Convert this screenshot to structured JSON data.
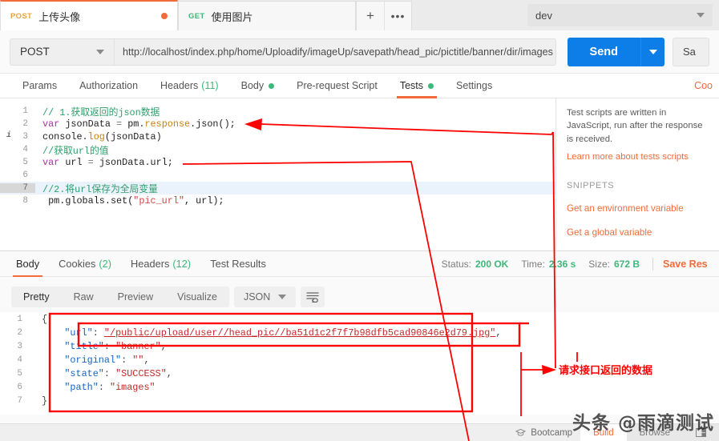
{
  "tabs": [
    {
      "method": "POST",
      "name": "上传头像",
      "active": true,
      "unsaved": true
    },
    {
      "method": "GET",
      "name": "使用图片",
      "active": false,
      "unsaved": false
    }
  ],
  "tab_tools": {
    "add": "+",
    "more": "•••"
  },
  "environment": {
    "selected": "dev"
  },
  "request": {
    "method": "POST",
    "url": "http://localhost/index.php/home/Uploadify/imageUp/savepath/head_pic/pictitle/banner/dir/images",
    "send_label": "Send",
    "save_label": "Sa"
  },
  "request_tabs": [
    {
      "label": "Params",
      "count": "",
      "dot": false,
      "active": false
    },
    {
      "label": "Authorization",
      "count": "",
      "dot": false,
      "active": false
    },
    {
      "label": "Headers",
      "count": "(11)",
      "dot": false,
      "active": false
    },
    {
      "label": "Body",
      "count": "",
      "dot": true,
      "active": false
    },
    {
      "label": "Pre-request Script",
      "count": "",
      "dot": false,
      "active": false
    },
    {
      "label": "Tests",
      "count": "",
      "dot": true,
      "active": true
    },
    {
      "label": "Settings",
      "count": "",
      "dot": false,
      "active": false
    }
  ],
  "cookies_link": "Coo",
  "code": {
    "lines": [
      {
        "num": "1",
        "text": "// 1.获取返回的json数据",
        "kind": "comment",
        "highlight": false,
        "info": false
      },
      {
        "num": "2",
        "text": "var jsonData = pm.response.json();",
        "kind": "code",
        "highlight": false,
        "info": false
      },
      {
        "num": "3",
        "text": "console.log(jsonData)",
        "kind": "code",
        "highlight": false,
        "info": true
      },
      {
        "num": "4",
        "text": "//获取url的值",
        "kind": "comment",
        "highlight": false,
        "info": false
      },
      {
        "num": "5",
        "text": "var url = jsonData.url;",
        "kind": "code",
        "highlight": false,
        "info": false
      },
      {
        "num": "6",
        "text": "",
        "kind": "code",
        "highlight": false,
        "info": false
      },
      {
        "num": "7",
        "text": "//2.将url保存为全局变量",
        "kind": "comment",
        "highlight": true,
        "info": false
      },
      {
        "num": "8",
        "text": " pm.globals.set(\"pic_url\", url);",
        "kind": "code",
        "highlight": false,
        "info": false
      }
    ]
  },
  "snippets": {
    "description": "Test scripts are written in JavaScript, run after the response is received.",
    "learn_more": "Learn more about tests scripts",
    "heading": "SNIPPETS",
    "items": [
      "Get an environment variable",
      "Get a global variable"
    ]
  },
  "response_tabs": [
    {
      "label": "Body",
      "count": "",
      "active": true
    },
    {
      "label": "Cookies",
      "count": "(2)",
      "active": false
    },
    {
      "label": "Headers",
      "count": "(12)",
      "active": false
    },
    {
      "label": "Test Results",
      "count": "",
      "active": false
    }
  ],
  "response_meta": {
    "status_label": "Status:",
    "status_value": "200 OK",
    "time_label": "Time:",
    "time_value": "2.36 s",
    "size_label": "Size:",
    "size_value": "672 B",
    "save_response": "Save Res"
  },
  "view_tabs": [
    {
      "label": "Pretty",
      "active": true
    },
    {
      "label": "Raw",
      "active": false
    },
    {
      "label": "Preview",
      "active": false
    },
    {
      "label": "Visualize",
      "active": false
    }
  ],
  "format": {
    "selected": "JSON"
  },
  "response_body": {
    "lines": [
      {
        "num": "1",
        "text": "{",
        "type": "brace"
      },
      {
        "num": "2",
        "key": "\"url\"",
        "value": "\"/public/upload/user//head_pic//ba51d1c2f7f7b98dfb5cad90846e2d79.jpg\"",
        "trail": ",",
        "type": "pair",
        "underline": true
      },
      {
        "num": "3",
        "key": "\"title\"",
        "value": "\"banner\"",
        "trail": ",",
        "type": "pair",
        "underline": false
      },
      {
        "num": "4",
        "key": "\"original\"",
        "value": "\"\"",
        "trail": ",",
        "type": "pair",
        "underline": false
      },
      {
        "num": "5",
        "key": "\"state\"",
        "value": "\"SUCCESS\"",
        "trail": ",",
        "type": "pair",
        "underline": false
      },
      {
        "num": "6",
        "key": "\"path\"",
        "value": "\"images\"",
        "trail": "",
        "type": "pair",
        "underline": false
      },
      {
        "num": "7",
        "text": "}",
        "type": "brace"
      }
    ]
  },
  "footer": {
    "bootcamp": "Bootcamp",
    "build": "Build",
    "browse": "Browse"
  },
  "annotation": {
    "text": "请求接口返回的数据",
    "color": "#ff0000"
  },
  "watermark": "头条 @雨滴测试"
}
